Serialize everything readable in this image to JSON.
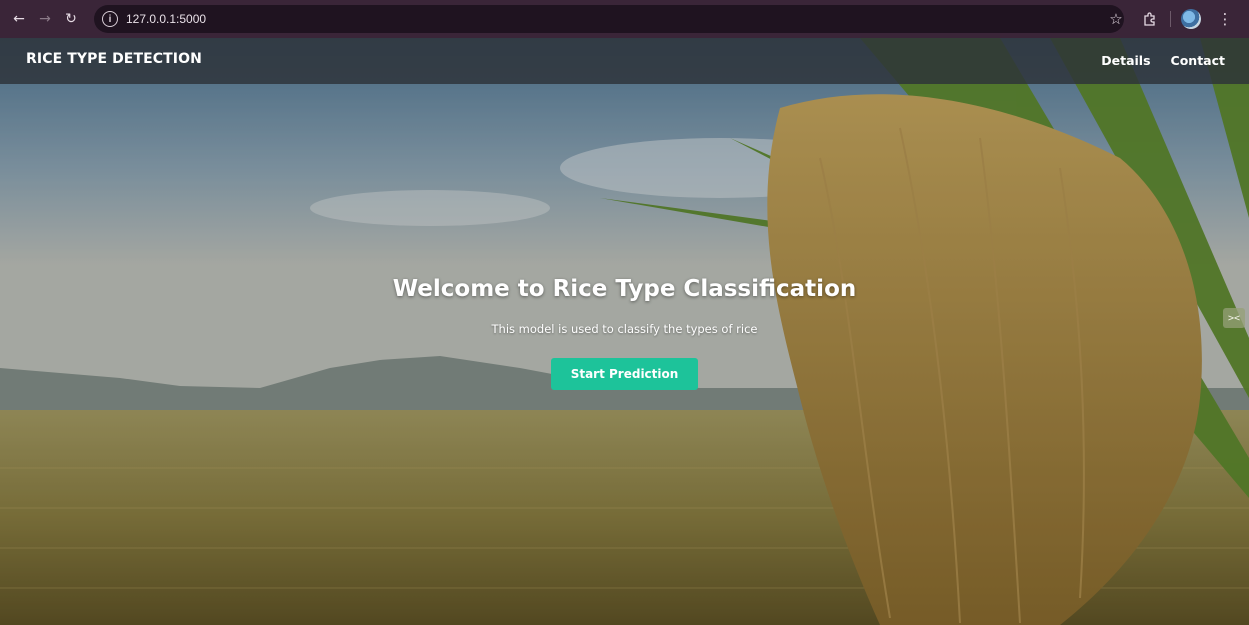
{
  "browser": {
    "url": "127.0.0.1:5000",
    "icons": {
      "back": "arrow-left-icon",
      "forward": "arrow-right-icon",
      "reload": "reload-icon",
      "site_info": "site-info-icon",
      "bookmark": "star-icon",
      "extensions": "puzzle-icon",
      "profile": "profile-avatar",
      "menu": "kebab-menu-icon"
    }
  },
  "navbar": {
    "brand": "RICE TYPE DETECTION",
    "links": [
      "Details",
      "Contact"
    ]
  },
  "hero": {
    "title": "Welcome to Rice Type Classification",
    "subtitle": "This model is used to classify the types of rice",
    "cta_label": "Start Prediction"
  },
  "colors": {
    "chrome_bg": "#3a2538",
    "navbar_bg": "#2d3238",
    "cta_bg": "#1dc39a",
    "text": "#ffffff"
  }
}
